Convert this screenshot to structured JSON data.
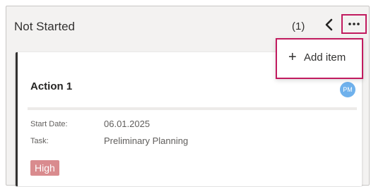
{
  "column": {
    "title": "Not Started",
    "count": "(1)"
  },
  "header_icons": {
    "collapse": "chevron-left-icon",
    "more": "more-horizontal-icon"
  },
  "menu": {
    "items": [
      {
        "icon": "plus-icon",
        "icon_glyph": "+",
        "label": "Add item"
      }
    ]
  },
  "card": {
    "title": "Action 1",
    "avatar_initials": "PM",
    "start_date_label": "Start Date:",
    "start_date_value": "06.01.2025",
    "task_label": "Task:",
    "task_value": "Preliminary Planning",
    "priority": "High"
  },
  "colors": {
    "highlight": "#c11b5f",
    "priority_high": "#d98b8e",
    "avatar": "#6fb1ec"
  }
}
